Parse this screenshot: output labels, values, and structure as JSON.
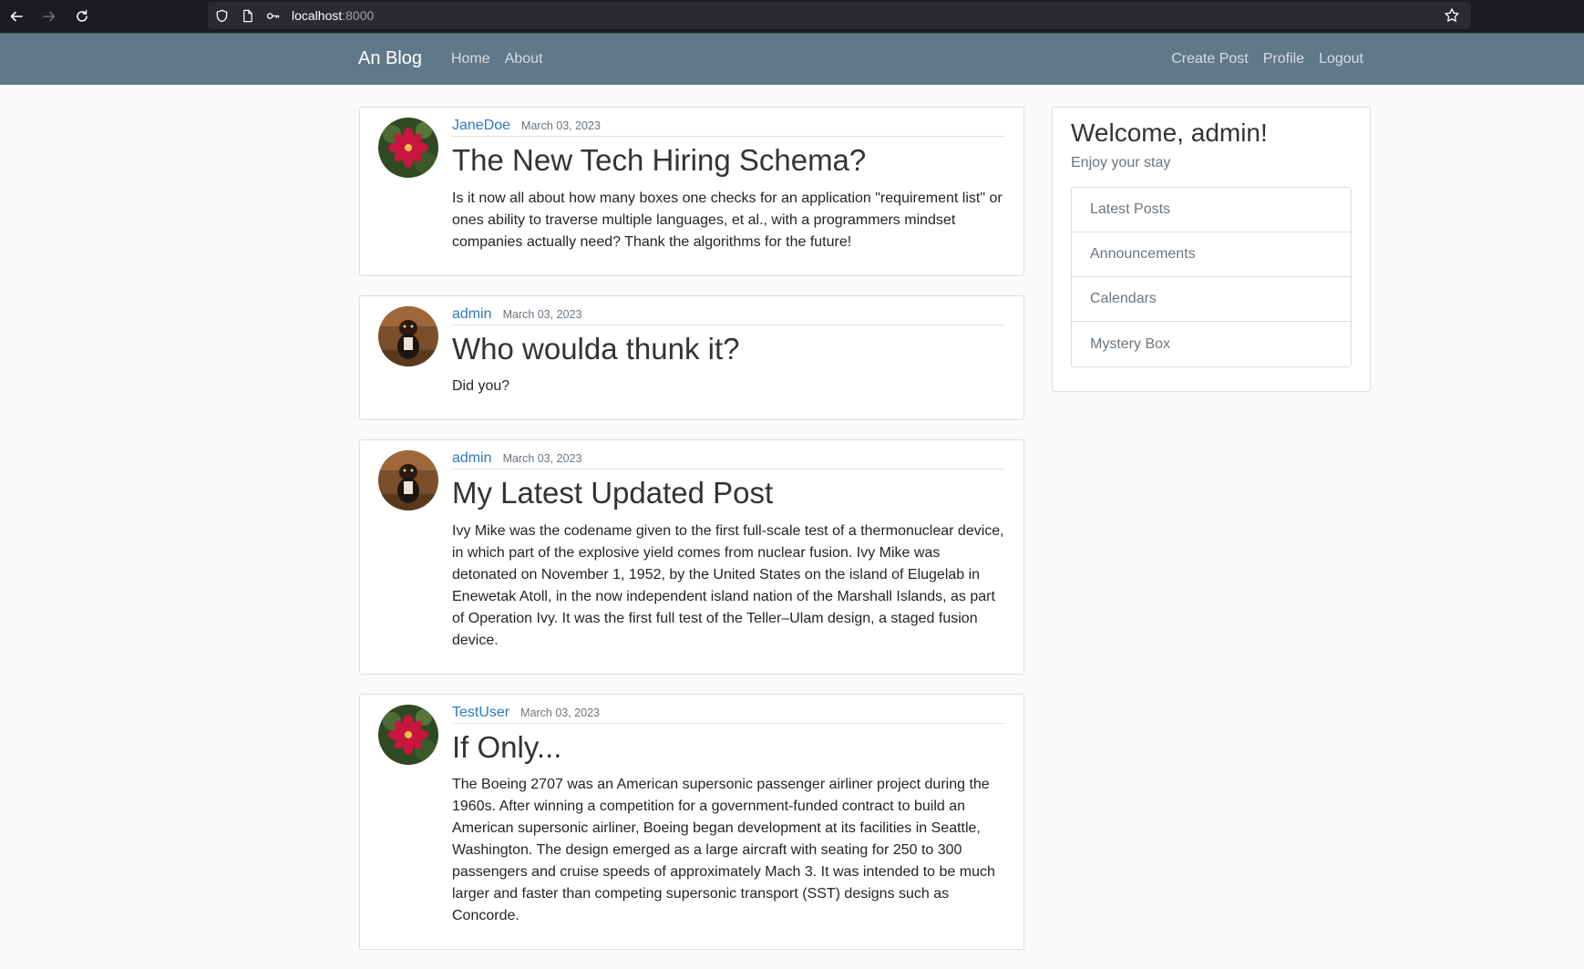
{
  "browser": {
    "url_host": "localhost",
    "url_port": ":8000"
  },
  "navbar": {
    "brand": "An Blog",
    "left_links": [
      "Home",
      "About"
    ],
    "right_links": [
      "Create Post",
      "Profile",
      "Logout"
    ]
  },
  "posts": [
    {
      "author": "JaneDoe",
      "date": "March 03, 2023",
      "title": "The New Tech Hiring Schema?",
      "content": "Is it now all about how many boxes one checks for an application \"requirement list\" or ones ability to traverse multiple languages, et al., with a programmers mindset companies actually need? Thank the algorithms for the future!",
      "avatar": "flower-avatar"
    },
    {
      "author": "admin",
      "date": "March 03, 2023",
      "title": "Who woulda thunk it?",
      "content": "Did you?",
      "avatar": "dog-avatar"
    },
    {
      "author": "admin",
      "date": "March 03, 2023",
      "title": "My Latest Updated Post",
      "content": "Ivy Mike was the codename given to the first full-scale test of a thermonuclear device, in which part of the explosive yield comes from nuclear fusion. Ivy Mike was detonated on November 1, 1952, by the United States on the island of Elugelab in Enewetak Atoll, in the now independent island nation of the Marshall Islands, as part of Operation Ivy. It was the first full test of the Teller–Ulam design, a staged fusion device.",
      "avatar": "dog-avatar"
    },
    {
      "author": "TestUser",
      "date": "March 03, 2023",
      "title": "If Only...",
      "content": "The Boeing 2707 was an American supersonic passenger airliner project during the 1960s. After winning a competition for a government-funded contract to build an American supersonic airliner, Boeing began development at its facilities in Seattle, Washington. The design emerged as a large aircraft with seating for 250 to 300 passengers and cruise speeds of approximately Mach 3. It was intended to be much larger and faster than competing supersonic transport (SST) designs such as Concorde.",
      "avatar": "flower-avatar"
    }
  ],
  "sidebar": {
    "welcome": "Welcome, admin!",
    "subtitle": "Enjoy your stay",
    "items": [
      "Latest Posts",
      "Announcements",
      "Calendars",
      "Mystery Box"
    ]
  }
}
